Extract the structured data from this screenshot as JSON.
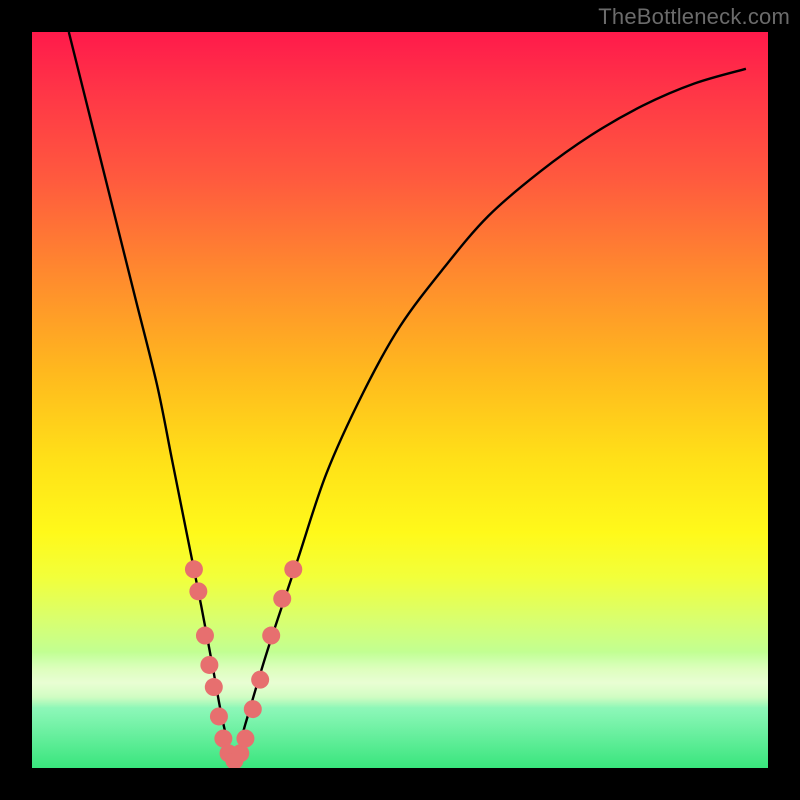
{
  "watermark": "TheBottleneck.com",
  "chart_data": {
    "type": "line",
    "title": "",
    "xlabel": "",
    "ylabel": "",
    "xlim": [
      0,
      100
    ],
    "ylim": [
      0,
      100
    ],
    "grid": false,
    "legend": false,
    "background_gradient": [
      "#ff1a4b",
      "#ff5a3e",
      "#ffb81e",
      "#fff91a",
      "#b9ffa0",
      "#39e57d"
    ],
    "series": [
      {
        "name": "bottleneck-curve",
        "x": [
          5,
          8,
          11,
          14,
          17,
          19,
          21,
          23,
          24.5,
          26,
          27.5,
          29,
          32,
          36,
          40,
          45,
          50,
          56,
          62,
          69,
          76,
          83,
          90,
          97
        ],
        "values": [
          100,
          88,
          76,
          64,
          52,
          42,
          32,
          22,
          14,
          6,
          1,
          6,
          16,
          28,
          40,
          51,
          60,
          68,
          75,
          81,
          86,
          90,
          93,
          95
        ]
      }
    ],
    "markers": [
      {
        "series": "bottleneck-curve",
        "x": 22.0,
        "y": 27
      },
      {
        "series": "bottleneck-curve",
        "x": 22.6,
        "y": 24
      },
      {
        "series": "bottleneck-curve",
        "x": 23.5,
        "y": 18
      },
      {
        "series": "bottleneck-curve",
        "x": 24.1,
        "y": 14
      },
      {
        "series": "bottleneck-curve",
        "x": 24.7,
        "y": 11
      },
      {
        "series": "bottleneck-curve",
        "x": 25.4,
        "y": 7
      },
      {
        "series": "bottleneck-curve",
        "x": 26.0,
        "y": 4
      },
      {
        "series": "bottleneck-curve",
        "x": 26.7,
        "y": 2
      },
      {
        "series": "bottleneck-curve",
        "x": 27.5,
        "y": 1
      },
      {
        "series": "bottleneck-curve",
        "x": 28.3,
        "y": 2
      },
      {
        "series": "bottleneck-curve",
        "x": 29.0,
        "y": 4
      },
      {
        "series": "bottleneck-curve",
        "x": 30.0,
        "y": 8
      },
      {
        "series": "bottleneck-curve",
        "x": 31.0,
        "y": 12
      },
      {
        "series": "bottleneck-curve",
        "x": 32.5,
        "y": 18
      },
      {
        "series": "bottleneck-curve",
        "x": 34.0,
        "y": 23
      },
      {
        "series": "bottleneck-curve",
        "x": 35.5,
        "y": 27
      }
    ],
    "marker_color": "#e76f6f",
    "curve_color": "#000000"
  },
  "colors": {
    "frame": "#000000",
    "watermark": "#6b6b6b"
  }
}
